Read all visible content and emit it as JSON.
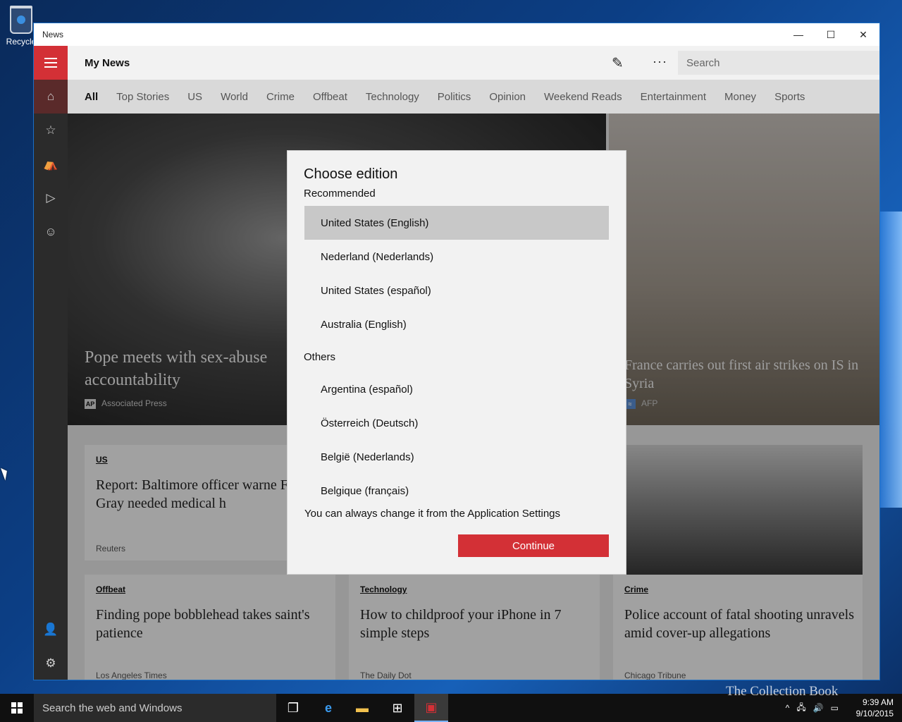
{
  "desktop": {
    "recycle_label": "Recycle"
  },
  "window": {
    "title": "News",
    "min": "—",
    "max": "☐",
    "close": "✕"
  },
  "app": {
    "title": "My News",
    "search_placeholder": "Search",
    "tabs": [
      "All",
      "Top Stories",
      "US",
      "World",
      "Crime",
      "Offbeat",
      "Technology",
      "Politics",
      "Opinion",
      "Weekend Reads",
      "Entertainment",
      "Money",
      "Sports"
    ]
  },
  "content": {
    "hero_left": {
      "headline": "Pope meets with sex-abuse accountability",
      "source": "Associated Press",
      "badge": "AP"
    },
    "hero_right": {
      "headline": "France carries out first air strikes on IS in Syria",
      "source": "AFP"
    },
    "cards": [
      {
        "category": "US",
        "title": "Report: Baltimore officer warne Freddie Gray needed medical h",
        "source": "Reuters"
      },
      {
        "category": "Offbeat",
        "title": "Finding pope bobblehead takes saint's patience",
        "source": "Los Angeles Times"
      },
      {
        "category": "Technology",
        "title": "How to childproof your iPhone in 7 simple steps",
        "source": "The Daily Dot"
      },
      {
        "category": "Crime",
        "title": "Police account of fatal shooting unravels amid cover-up allegations",
        "source": "Chicago Tribune"
      }
    ]
  },
  "dialog": {
    "title": "Choose edition",
    "recommended_label": "Recommended",
    "recommended": [
      "United States (English)",
      "Nederland (Nederlands)",
      "United States (español)",
      "Australia (English)"
    ],
    "others_label": "Others",
    "others": [
      "Argentina (español)",
      "Österreich (Deutsch)",
      "België (Nederlands)",
      "Belgique (français)"
    ],
    "note": "You can always change it from the Application Settings",
    "continue": "Continue",
    "selected_index": 0
  },
  "taskbar": {
    "search": "Search the web and Windows",
    "time": "9:39 AM",
    "date": "9/10/2015",
    "watermark": "The Collection Book"
  },
  "colors": {
    "accent": "#d33036",
    "window_border": "#1b6fc6"
  }
}
